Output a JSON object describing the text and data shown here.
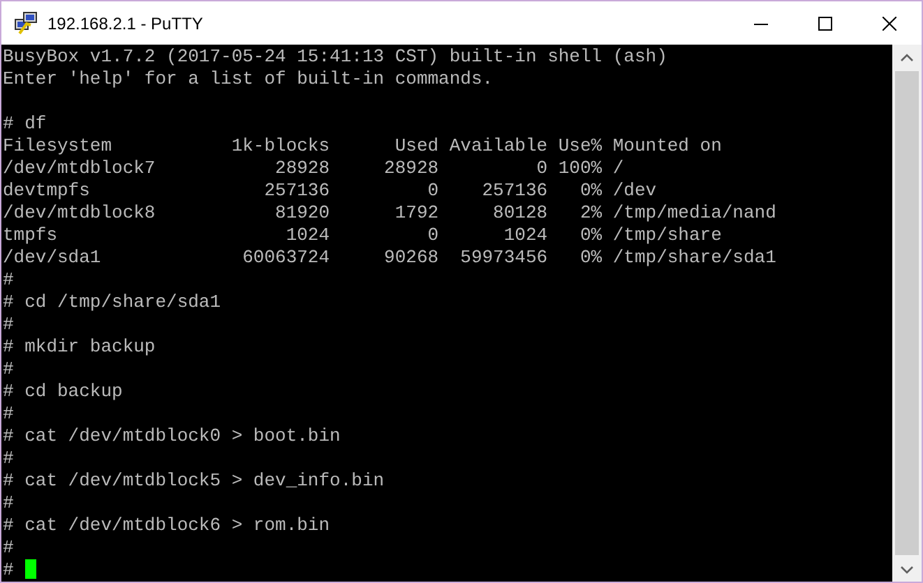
{
  "window": {
    "title": "192.168.2.1 - PuTTY"
  },
  "terminal": {
    "banner": [
      "BusyBox v1.7.2 (2017-05-24 15:41:13 CST) built-in shell (ash)",
      "Enter 'help' for a list of built-in commands."
    ],
    "output": [
      "# df",
      "Filesystem           1k-blocks      Used Available Use% Mounted on",
      "/dev/mtdblock7           28928     28928         0 100% /",
      "devtmpfs                257136         0    257136   0% /dev",
      "/dev/mtdblock8           81920      1792     80128   2% /tmp/media/nand",
      "tmpfs                     1024         0      1024   0% /tmp/share",
      "/dev/sda1             60063724     90268  59973456   0% /tmp/share/sda1",
      "#",
      "# cd /tmp/share/sda1",
      "#",
      "# mkdir backup",
      "#",
      "# cd backup",
      "#",
      "# cat /dev/mtdblock0 > boot.bin",
      "#",
      "# cat /dev/mtdblock5 > dev_info.bin",
      "#",
      "# cat /dev/mtdblock6 > rom.bin",
      "#"
    ],
    "prompt": "#",
    "cursor_shown": true
  }
}
